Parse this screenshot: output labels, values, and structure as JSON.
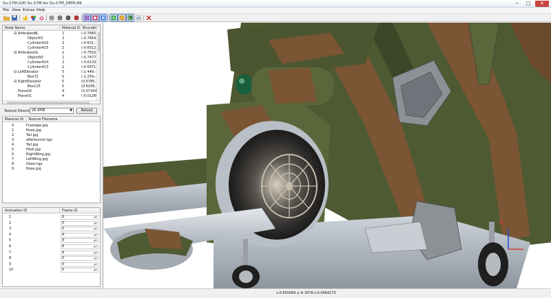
{
  "window": {
    "title": "Su-17M.LOD  Su-17M.lev  Su-17M_DATA.INI",
    "minimize_glyph": "─",
    "maximize_glyph": "□",
    "close_glyph": "✕"
  },
  "menu": [
    "File",
    "View",
    "Extras",
    "Help"
  ],
  "toolbar": {
    "icons": [
      "open-folder-icon",
      "save-disk-icon",
      "model-light-icon",
      "model-color-icon",
      "lod-cube-icon",
      "lod-cube-2-icon",
      "lod-cube-3-icon",
      "lod-cube-red-icon",
      "wireframe-toggle-icon",
      "shaded-toggle-icon",
      "texture-toggle-icon",
      "grid-toggle-icon",
      "normals-toggle-icon",
      "axes-toggle-icon",
      "chart-toggle-icon",
      "exit-icon"
    ]
  },
  "node_tree": {
    "columns": [
      "Node Name",
      "Material ID",
      "Bounding"
    ],
    "rows": [
      {
        "name": "AirbrakesBL",
        "indent": 1,
        "expander": "⊟",
        "material": "2",
        "bounds": "(-0.7665,-"
      },
      {
        "name": "Object02",
        "indent": 2,
        "expander": "",
        "material": "2",
        "bounds": "(-0.7664,-"
      },
      {
        "name": "Cylinder416",
        "indent": 2,
        "expander": "",
        "material": "2",
        "bounds": "(-0.631,-1"
      },
      {
        "name": "Cylinder415",
        "indent": 2,
        "expander": "",
        "material": "2",
        "bounds": "(-0.6512,-"
      },
      {
        "name": "AirbrakesUL",
        "indent": 1,
        "expander": "⊟",
        "material": "2",
        "bounds": "(-0.7502,-"
      },
      {
        "name": "Object00",
        "indent": 2,
        "expander": "",
        "material": "2",
        "bounds": "(-0.7477,-"
      },
      {
        "name": "Cylinder414",
        "indent": 2,
        "expander": "",
        "material": "2",
        "bounds": "(-0.6129,-"
      },
      {
        "name": "Cylinder413",
        "indent": 2,
        "expander": "",
        "material": "2",
        "bounds": "(-0.5971,-"
      },
      {
        "name": "LeftElevator",
        "indent": 1,
        "expander": "⊟",
        "material": "5",
        "bounds": "(-2.449,-8"
      },
      {
        "name": "Box72",
        "indent": 2,
        "expander": "",
        "material": "5",
        "bounds": "(-2.254,-8"
      },
      {
        "name": "RightElevator",
        "indent": 1,
        "expander": "⊟",
        "material": "5",
        "bounds": "(0.5785,-8"
      },
      {
        "name": "Box125",
        "indent": 2,
        "expander": "",
        "material": "5",
        "bounds": "(0.6166,-8"
      },
      {
        "name": "Plane02",
        "indent": 1,
        "expander": "",
        "material": "4",
        "bounds": "(0.07304,-"
      },
      {
        "name": "Plane01",
        "indent": 1,
        "expander": "",
        "material": "4",
        "bounds": "(-0.01266,"
      }
    ]
  },
  "texture_directory": {
    "label": "Texture Directory:",
    "selected": "26 APIB",
    "reload_label": "Reload"
  },
  "materials": {
    "columns": [
      "Material ID",
      "Texture Filename"
    ],
    "rows": [
      {
        "id": "0",
        "file": "Fuselage.jpg"
      },
      {
        "id": "1",
        "file": "Nose.jpg"
      },
      {
        "id": "2",
        "file": "Tail.jpg"
      },
      {
        "id": "3",
        "file": "afterburner.tga"
      },
      {
        "id": "4",
        "file": "Tail.jpg"
      },
      {
        "id": "5",
        "file": "Htail.jpg"
      },
      {
        "id": "6",
        "file": "RightWing.jpg"
      },
      {
        "id": "7",
        "file": "LeftWing.jpg"
      },
      {
        "id": "8",
        "file": "Glass.tga"
      },
      {
        "id": "9",
        "file": "Nose.jpg"
      }
    ]
  },
  "animations": {
    "columns": [
      "Animation ID",
      "Frame ID"
    ],
    "rows": [
      {
        "id": "1",
        "frame": "9"
      },
      {
        "id": "2",
        "frame": "0"
      },
      {
        "id": "3",
        "frame": "0"
      },
      {
        "id": "4",
        "frame": "9"
      },
      {
        "id": "5",
        "frame": "9"
      },
      {
        "id": "6",
        "frame": "8"
      },
      {
        "id": "7",
        "frame": "9"
      },
      {
        "id": "8",
        "frame": "0"
      },
      {
        "id": "9",
        "frame": "0"
      },
      {
        "id": "10",
        "frame": "0"
      }
    ]
  },
  "status": {
    "coordinates": "x:0.655066 y:-6.3078 z:0.0464173"
  },
  "colors": {
    "camo_green": "#4e5a32",
    "camo_brown": "#7b5534",
    "belly_grey": "#b7bec6",
    "selection_blue": "#3a6fc4"
  }
}
